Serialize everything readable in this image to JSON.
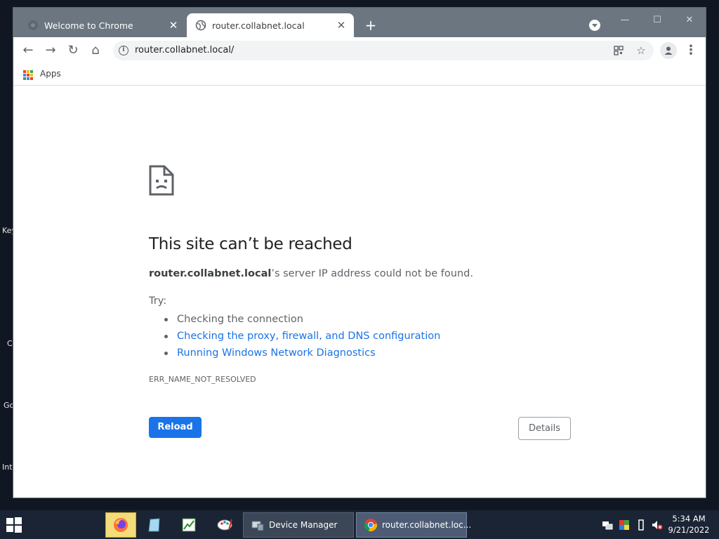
{
  "desktop": {
    "labels": [
      "Key",
      "C",
      "Go",
      "Int"
    ]
  },
  "browser": {
    "tabs": [
      {
        "title": "Welcome to Chrome",
        "close": "✕",
        "active": false
      },
      {
        "title": "router.collabnet.local",
        "close": "✕",
        "active": true
      }
    ],
    "new_tab": "+",
    "window_controls": {
      "minimize": "—",
      "maximize": "☐",
      "close": "✕"
    },
    "toolbar": {
      "back": "←",
      "forward": "→",
      "reload": "↻",
      "home": "⌂",
      "url": "router.collabnet.local/",
      "bookmark_star": "☆",
      "menu": "⋮"
    },
    "bookmarks": {
      "apps_label": "Apps",
      "apps_colors": [
        "#ea4335",
        "#fbbc04",
        "#34a853",
        "#4285f4",
        "#ea4335",
        "#fbbc04",
        "#34a853",
        "#4285f4",
        "#ea4335"
      ]
    }
  },
  "error_page": {
    "title": "This site can’t be reached",
    "host": "router.collabnet.local",
    "description_suffix": "’s server IP address could not be found.",
    "try_label": "Try:",
    "suggestions": [
      {
        "text": "Checking the connection",
        "link": false
      },
      {
        "text": "Checking the proxy, firewall, and DNS configuration",
        "link": true
      },
      {
        "text": "Running Windows Network Diagnostics",
        "link": true
      }
    ],
    "error_code": "ERR_NAME_NOT_RESOLVED",
    "reload_label": "Reload",
    "details_label": "Details"
  },
  "taskbar": {
    "apps": [
      {
        "label": "Device Manager"
      },
      {
        "label": "router.collabnet.loc..."
      }
    ],
    "clock": {
      "time": "5:34 AM",
      "date": "9/21/2022"
    },
    "colors": {
      "accent": "#1a73e8",
      "taskbar": "#1a2434"
    }
  }
}
